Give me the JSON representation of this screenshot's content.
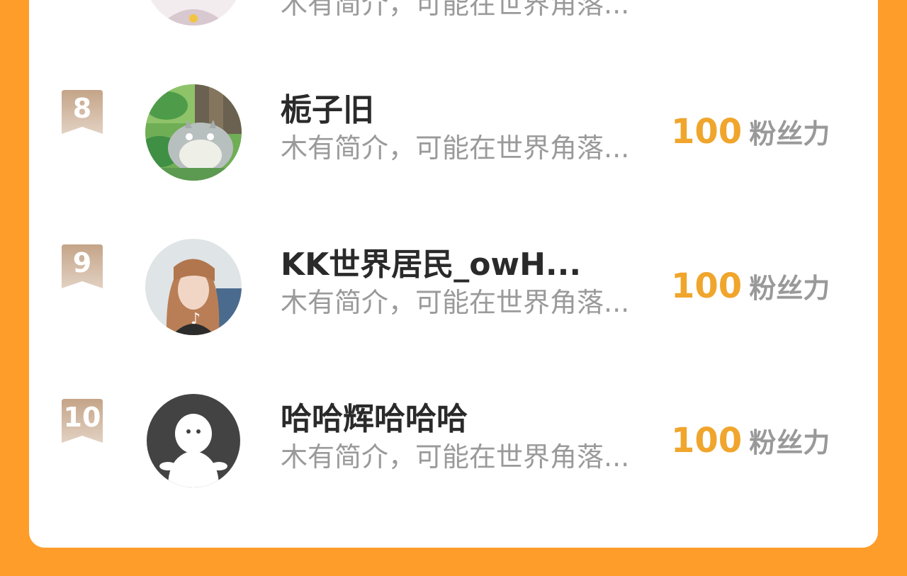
{
  "colors": {
    "background": "#FF9D2B",
    "card": "#FFFFFF",
    "score": "#F0A52C",
    "rank_badge": "#C9AE94",
    "name": "#2A2A2A",
    "bio": "#9A9A9A",
    "unit": "#999999"
  },
  "list": {
    "partial_item": {
      "bio": "木有简介，可能在世界角落..."
    },
    "items": [
      {
        "rank": "8",
        "name": "栀子旧",
        "bio": "木有简介，可能在世界角落...",
        "score": "100",
        "unit": "粉丝力",
        "avatar": "totoro-avatar"
      },
      {
        "rank": "9",
        "name": "KK世界居民_owH...",
        "bio": "木有简介，可能在世界角落...",
        "score": "100",
        "unit": "粉丝力",
        "avatar": "girl-photo-avatar"
      },
      {
        "rank": "10",
        "name": "哈哈辉哈哈哈",
        "bio": "木有简介，可能在世界角落...",
        "score": "100",
        "unit": "粉丝力",
        "avatar": "default-avatar"
      }
    ]
  }
}
